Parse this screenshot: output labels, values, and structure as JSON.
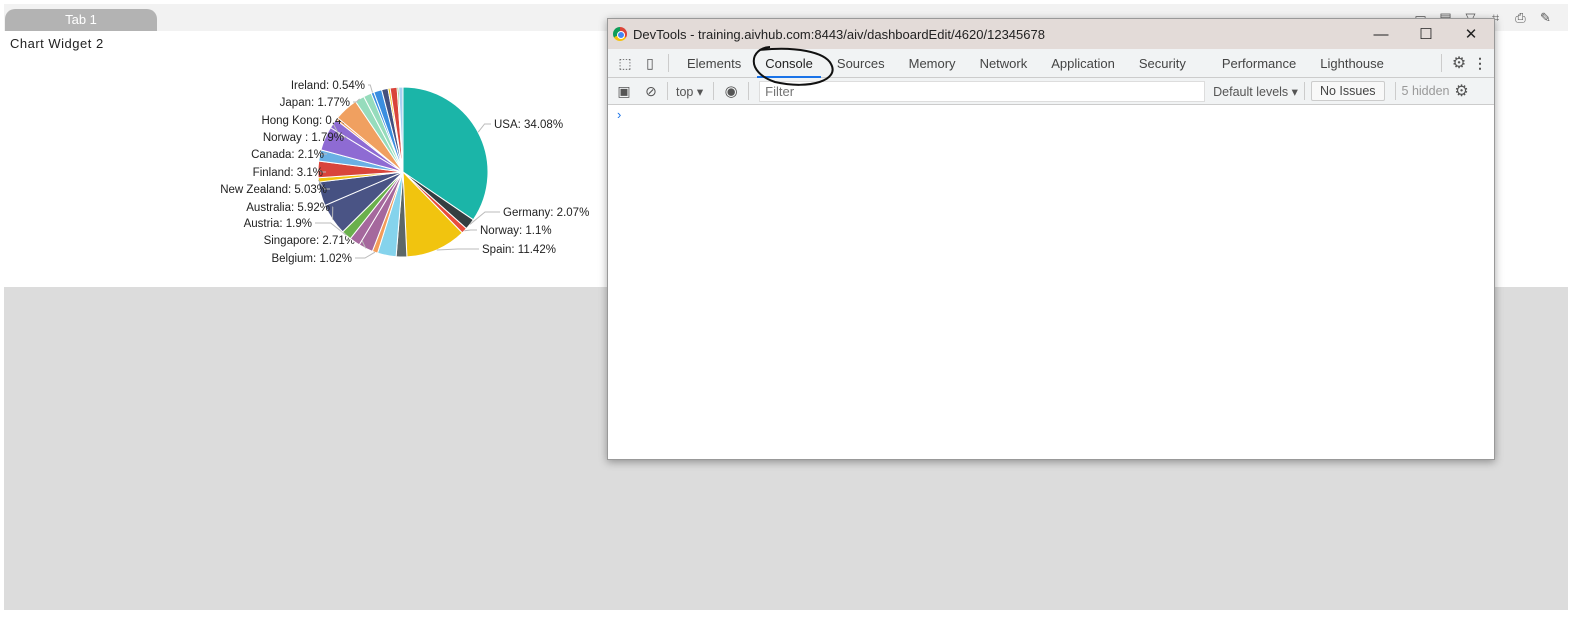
{
  "page": {
    "tab_label": "Tab 1",
    "widget_title": "Chart Widget 2",
    "toolbar_icons": [
      "comment-icon",
      "notes-icon",
      "filter-icon",
      "crop-icon",
      "print-icon",
      "edit-icon"
    ]
  },
  "devtools": {
    "title": "DevTools - training.aivhub.com:8443/aiv/dashboardEdit/4620/12345678",
    "tabs": [
      "Elements",
      "Console",
      "Sources",
      "Memory",
      "Network",
      "Application",
      "Security",
      "Performance",
      "Lighthouse"
    ],
    "active_tab": "Console",
    "context": "top",
    "filter_placeholder": "Filter",
    "levels": "Default levels",
    "issues": "No Issues",
    "hidden": "5 hidden",
    "prompt": "›",
    "accent": "#1a73e8"
  },
  "chart_data": {
    "type": "pie",
    "slices": [
      {
        "label": "USA: 34.08%",
        "value": 34.08,
        "color": "#1bb5a8"
      },
      {
        "label": "Germany: 2.07%",
        "value": 2.07,
        "color": "#343e41"
      },
      {
        "label": "Norway: 1.1%",
        "value": 1.1,
        "color": "#e74c3c"
      },
      {
        "label": "Spain: 11.42%",
        "value": 11.42,
        "color": "#f1c40f"
      },
      {
        "label": "",
        "value": 2.0,
        "color": "#5d6768"
      },
      {
        "label": "",
        "value": 3.5,
        "color": "#85d3ec"
      },
      {
        "label": "Belgium: 1.02%",
        "value": 1.02,
        "color": "#f39c5a"
      },
      {
        "label": "Singapore: 2.71%",
        "value": 2.71,
        "color": "#a5689d"
      },
      {
        "label": "",
        "value": 2.0,
        "color": "#a5689d"
      },
      {
        "label": "Austria: 1.9%",
        "value": 1.9,
        "color": "#6ab04c"
      },
      {
        "label": "Australia: 5.92%",
        "value": 5.92,
        "color": "#4a5485"
      },
      {
        "label": "",
        "value": 4.5,
        "color": "#465182"
      },
      {
        "label": "New Zealand: 5.03%",
        "value": 0.8,
        "color": "#f1c40f"
      },
      {
        "label": "Finland: 3.1%",
        "value": 3.1,
        "color": "#d9453b"
      },
      {
        "label": "Canada: 2.1%",
        "value": 2.1,
        "color": "#6ab0e4"
      },
      {
        "label": "",
        "value": 4.5,
        "color": "#8e6bd3"
      },
      {
        "label": "Norway : 1.79%",
        "value": 1.79,
        "color": "#8e6bd3"
      },
      {
        "label": "Hong Kong: 0.46%",
        "value": 0.46,
        "color": "#f39c5a"
      },
      {
        "label": "",
        "value": 4.5,
        "color": "#f0a060"
      },
      {
        "label": "Japan: 1.77%",
        "value": 1.77,
        "color": "#96dcbc"
      },
      {
        "label": "",
        "value": 1.5,
        "color": "#96dcbc"
      },
      {
        "label": "Ireland: 0.54%",
        "value": 0.54,
        "color": "#3a8ee0"
      },
      {
        "label": "",
        "value": 1.5,
        "color": "#3a8ee0"
      },
      {
        "label": "",
        "value": 1.2,
        "color": "#44507e"
      },
      {
        "label": "",
        "value": 0.4,
        "color": "#f1c40f"
      },
      {
        "label": "",
        "value": 1.3,
        "color": "#d9453b"
      },
      {
        "label": "",
        "value": 0.3,
        "color": "#6ab04c"
      },
      {
        "label": "",
        "value": 0.8,
        "color": "#a8d0f0"
      }
    ]
  }
}
